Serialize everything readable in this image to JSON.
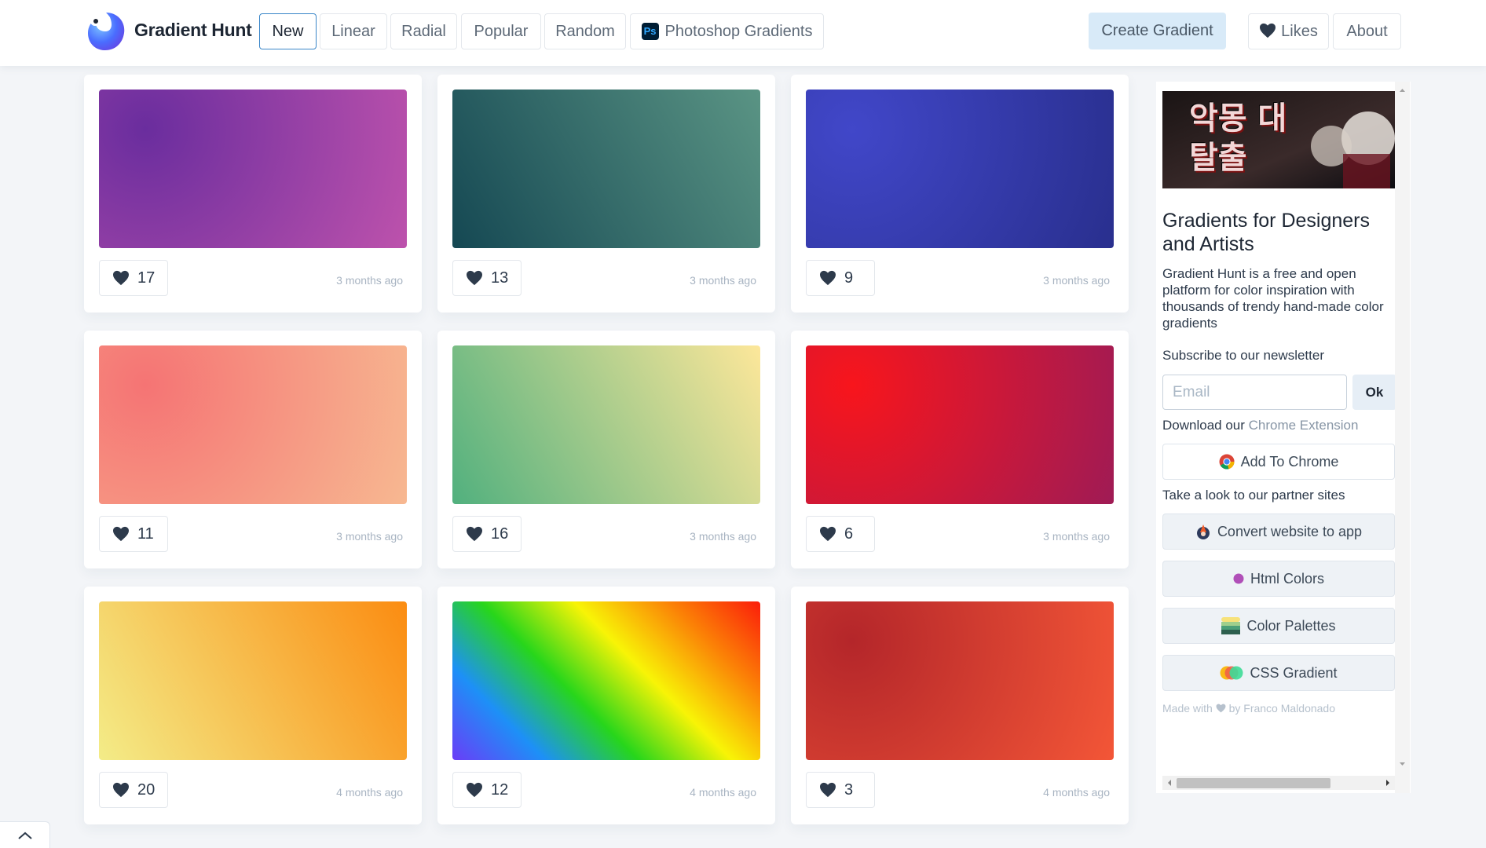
{
  "brand": {
    "name": "Gradient Hunt"
  },
  "nav": {
    "new": "New",
    "linear": "Linear",
    "radial": "Radial",
    "popular": "Popular",
    "random": "Random",
    "photoshop": "Photoshop Gradients",
    "ps_badge": "Ps",
    "create": "Create Gradient",
    "likes": "Likes",
    "about": "About"
  },
  "cards": [
    {
      "likes": "17",
      "time": "3 months ago",
      "gradient_type": "radial",
      "colors": [
        "#6a2d9e",
        "#bd52ac"
      ]
    },
    {
      "likes": "13",
      "time": "3 months ago",
      "gradient_type": "linear",
      "colors": [
        "#154853",
        "#5a9484"
      ]
    },
    {
      "likes": "9",
      "time": "3 months ago",
      "gradient_type": "radial",
      "colors": [
        "#4147c9",
        "#292f8e"
      ]
    },
    {
      "likes": "11",
      "time": "3 months ago",
      "gradient_type": "radial",
      "colors": [
        "#f57474",
        "#f7b891"
      ]
    },
    {
      "likes": "16",
      "time": "3 months ago",
      "gradient_type": "linear",
      "colors": [
        "#51b07e",
        "#fde79a"
      ]
    },
    {
      "likes": "6",
      "time": "3 months ago",
      "gradient_type": "radial",
      "colors": [
        "#f8151c",
        "#9f1b55"
      ]
    },
    {
      "likes": "20",
      "time": "4 months ago",
      "gradient_type": "linear",
      "colors": [
        "#f3ec88",
        "#fb8c11"
      ]
    },
    {
      "likes": "12",
      "time": "4 months ago",
      "gradient_type": "linear",
      "colors": [
        "#6a3df7",
        "#1d90f7",
        "#27d61b",
        "#f8f406",
        "#fb8406",
        "#fb1d0a"
      ]
    },
    {
      "likes": "3",
      "time": "4 months ago",
      "gradient_type": "radial",
      "colors": [
        "#b4262a",
        "#f35637"
      ]
    }
  ],
  "sidebar": {
    "ad_text": "악몽 대탈출",
    "title": "Gradients for Designers and Artists",
    "description": "Gradient Hunt is a free and open platform for color inspiration with thousands of trendy hand-made color gradients",
    "newsletter_label": "Subscribe to our newsletter",
    "email_placeholder": "Email",
    "ok": "Ok",
    "download_prefix": "Download our ",
    "download_link": "Chrome Extension",
    "add_to_chrome": "Add To Chrome",
    "partner_label": "Take a look to our partner sites",
    "partners": {
      "convert": "Convert website to app",
      "html_colors": "Html Colors",
      "color_palettes": "Color Palettes",
      "css_gradient": "CSS Gradient"
    },
    "made_with_prefix": "Made with",
    "made_with_suffix": " by Franco Maldonado"
  },
  "colors": {
    "accent": "#3a86c8",
    "heart": "#2d3a4b",
    "create_bg": "#d8eaf8"
  }
}
